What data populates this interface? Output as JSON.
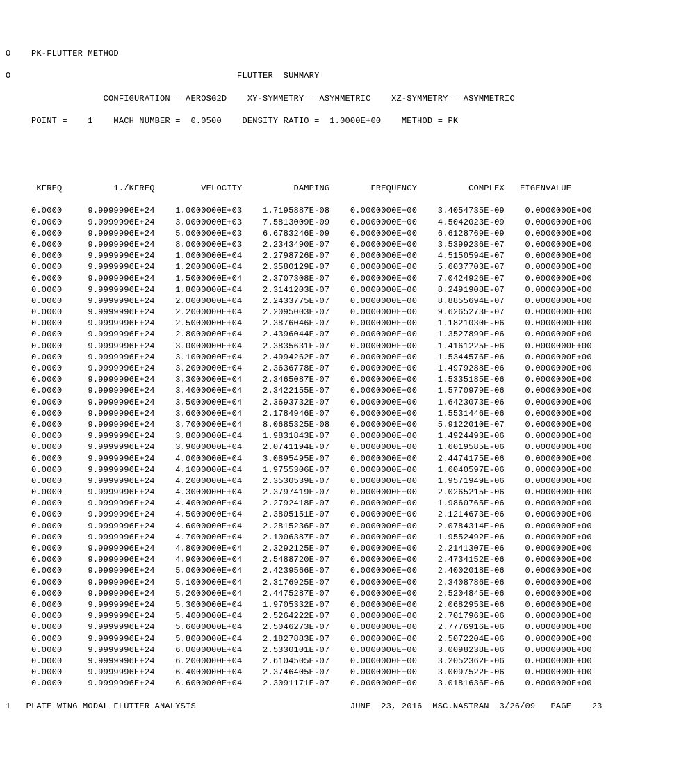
{
  "header": {
    "line0": "O    PK-FLUTTER METHOD",
    "line1": "O                                            FLUTTER  SUMMARY",
    "config_label": "CONFIGURATION =",
    "config_value": "AEROSG2D",
    "xy_label": "XY-SYMMETRY =",
    "xy_value": "ASYMMETRIC",
    "xz_label": "XZ-SYMMETRY =",
    "xz_value": "ASYMMETRIC",
    "point_label": "POINT =",
    "point_value": "1",
    "mach_label": "MACH NUMBER =",
    "mach_value": "0.0500",
    "density_label": "DENSITY RATIO =",
    "density_value": "1.0000E+00",
    "method_label": "METHOD =",
    "method_value": "PK"
  },
  "columns": [
    "KFREQ",
    "1./KFREQ",
    "VELOCITY",
    "DAMPING",
    "FREQUENCY",
    "COMPLEX",
    "EIGENVALUE"
  ],
  "rows": [
    [
      "0.0000",
      "9.9999996E+24",
      "1.0000000E+03",
      "1.7195887E-08",
      "0.0000000E+00",
      "3.4054735E-09",
      "0.0000000E+00"
    ],
    [
      "0.0000",
      "9.9999996E+24",
      "3.0000000E+03",
      "7.5813009E-09",
      "0.0000000E+00",
      "4.5042023E-09",
      "0.0000000E+00"
    ],
    [
      "0.0000",
      "9.9999996E+24",
      "5.0000000E+03",
      "6.6783246E-09",
      "0.0000000E+00",
      "6.6128769E-09",
      "0.0000000E+00"
    ],
    [
      "0.0000",
      "9.9999996E+24",
      "8.0000000E+03",
      "2.2343490E-07",
      "0.0000000E+00",
      "3.5399236E-07",
      "0.0000000E+00"
    ],
    [
      "0.0000",
      "9.9999996E+24",
      "1.0000000E+04",
      "2.2798726E-07",
      "0.0000000E+00",
      "4.5150594E-07",
      "0.0000000E+00"
    ],
    [
      "0.0000",
      "9.9999996E+24",
      "1.2000000E+04",
      "2.3580129E-07",
      "0.0000000E+00",
      "5.6037703E-07",
      "0.0000000E+00"
    ],
    [
      "0.0000",
      "9.9999996E+24",
      "1.5000000E+04",
      "2.3707308E-07",
      "0.0000000E+00",
      "7.0424926E-07",
      "0.0000000E+00"
    ],
    [
      "0.0000",
      "9.9999996E+24",
      "1.8000000E+04",
      "2.3141203E-07",
      "0.0000000E+00",
      "8.2491908E-07",
      "0.0000000E+00"
    ],
    [
      "0.0000",
      "9.9999996E+24",
      "2.0000000E+04",
      "2.2433775E-07",
      "0.0000000E+00",
      "8.8855694E-07",
      "0.0000000E+00"
    ],
    [
      "0.0000",
      "9.9999996E+24",
      "2.2000000E+04",
      "2.2095003E-07",
      "0.0000000E+00",
      "9.6265273E-07",
      "0.0000000E+00"
    ],
    [
      "0.0000",
      "9.9999996E+24",
      "2.5000000E+04",
      "2.3876046E-07",
      "0.0000000E+00",
      "1.1821030E-06",
      "0.0000000E+00"
    ],
    [
      "0.0000",
      "9.9999996E+24",
      "2.8000000E+04",
      "2.4396044E-07",
      "0.0000000E+00",
      "1.3527899E-06",
      "0.0000000E+00"
    ],
    [
      "0.0000",
      "9.9999996E+24",
      "3.0000000E+04",
      "2.3835631E-07",
      "0.0000000E+00",
      "1.4161225E-06",
      "0.0000000E+00"
    ],
    [
      "0.0000",
      "9.9999996E+24",
      "3.1000000E+04",
      "2.4994262E-07",
      "0.0000000E+00",
      "1.5344576E-06",
      "0.0000000E+00"
    ],
    [
      "0.0000",
      "9.9999996E+24",
      "3.2000000E+04",
      "2.3636778E-07",
      "0.0000000E+00",
      "1.4979288E-06",
      "0.0000000E+00"
    ],
    [
      "0.0000",
      "9.9999996E+24",
      "3.3000000E+04",
      "2.3465087E-07",
      "0.0000000E+00",
      "1.5335185E-06",
      "0.0000000E+00"
    ],
    [
      "0.0000",
      "9.9999996E+24",
      "3.4000000E+04",
      "2.3422155E-07",
      "0.0000000E+00",
      "1.5770979E-06",
      "0.0000000E+00"
    ],
    [
      "0.0000",
      "9.9999996E+24",
      "3.5000000E+04",
      "2.3693732E-07",
      "0.0000000E+00",
      "1.6423073E-06",
      "0.0000000E+00"
    ],
    [
      "0.0000",
      "9.9999996E+24",
      "3.6000000E+04",
      "2.1784946E-07",
      "0.0000000E+00",
      "1.5531446E-06",
      "0.0000000E+00"
    ],
    [
      "0.0000",
      "9.9999996E+24",
      "3.7000000E+04",
      "8.0685325E-08",
      "0.0000000E+00",
      "5.9122010E-07",
      "0.0000000E+00"
    ],
    [
      "0.0000",
      "9.9999996E+24",
      "3.8000000E+04",
      "1.9831843E-07",
      "0.0000000E+00",
      "1.4924493E-06",
      "0.0000000E+00"
    ],
    [
      "0.0000",
      "9.9999996E+24",
      "3.9000000E+04",
      "2.0741194E-07",
      "0.0000000E+00",
      "1.6019585E-06",
      "0.0000000E+00"
    ],
    [
      "0.0000",
      "9.9999996E+24",
      "4.0000000E+04",
      "3.0895495E-07",
      "0.0000000E+00",
      "2.4474175E-06",
      "0.0000000E+00"
    ],
    [
      "0.0000",
      "9.9999996E+24",
      "4.1000000E+04",
      "1.9755306E-07",
      "0.0000000E+00",
      "1.6040597E-06",
      "0.0000000E+00"
    ],
    [
      "0.0000",
      "9.9999996E+24",
      "4.2000000E+04",
      "2.3530539E-07",
      "0.0000000E+00",
      "1.9571949E-06",
      "0.0000000E+00"
    ],
    [
      "0.0000",
      "9.9999996E+24",
      "4.3000000E+04",
      "2.3797419E-07",
      "0.0000000E+00",
      "2.0265215E-06",
      "0.0000000E+00"
    ],
    [
      "0.0000",
      "9.9999996E+24",
      "4.4000000E+04",
      "2.2792418E-07",
      "0.0000000E+00",
      "1.9860765E-06",
      "0.0000000E+00"
    ],
    [
      "0.0000",
      "9.9999996E+24",
      "4.5000000E+04",
      "2.3805151E-07",
      "0.0000000E+00",
      "2.1214673E-06",
      "0.0000000E+00"
    ],
    [
      "0.0000",
      "9.9999996E+24",
      "4.6000000E+04",
      "2.2815236E-07",
      "0.0000000E+00",
      "2.0784314E-06",
      "0.0000000E+00"
    ],
    [
      "0.0000",
      "9.9999996E+24",
      "4.7000000E+04",
      "2.1006387E-07",
      "0.0000000E+00",
      "1.9552492E-06",
      "0.0000000E+00"
    ],
    [
      "0.0000",
      "9.9999996E+24",
      "4.8000000E+04",
      "2.3292125E-07",
      "0.0000000E+00",
      "2.2141307E-06",
      "0.0000000E+00"
    ],
    [
      "0.0000",
      "9.9999996E+24",
      "4.9000000E+04",
      "2.5488720E-07",
      "0.0000000E+00",
      "2.4734152E-06",
      "0.0000000E+00"
    ],
    [
      "0.0000",
      "9.9999996E+24",
      "5.0000000E+04",
      "2.4239566E-07",
      "0.0000000E+00",
      "2.4002018E-06",
      "0.0000000E+00"
    ],
    [
      "0.0000",
      "9.9999996E+24",
      "5.1000000E+04",
      "2.3176925E-07",
      "0.0000000E+00",
      "2.3408786E-06",
      "0.0000000E+00"
    ],
    [
      "0.0000",
      "9.9999996E+24",
      "5.2000000E+04",
      "2.4475287E-07",
      "0.0000000E+00",
      "2.5204845E-06",
      "0.0000000E+00"
    ],
    [
      "0.0000",
      "9.9999996E+24",
      "5.3000000E+04",
      "1.9705332E-07",
      "0.0000000E+00",
      "2.0682953E-06",
      "0.0000000E+00"
    ],
    [
      "0.0000",
      "9.9999996E+24",
      "5.4000000E+04",
      "2.5264222E-07",
      "0.0000000E+00",
      "2.7017963E-06",
      "0.0000000E+00"
    ],
    [
      "0.0000",
      "9.9999996E+24",
      "5.6000000E+04",
      "2.5046273E-07",
      "0.0000000E+00",
      "2.7776916E-06",
      "0.0000000E+00"
    ],
    [
      "0.0000",
      "9.9999996E+24",
      "5.8000000E+04",
      "2.1827883E-07",
      "0.0000000E+00",
      "2.5072204E-06",
      "0.0000000E+00"
    ],
    [
      "0.0000",
      "9.9999996E+24",
      "6.0000000E+04",
      "2.5330101E-07",
      "0.0000000E+00",
      "3.0098238E-06",
      "0.0000000E+00"
    ],
    [
      "0.0000",
      "9.9999996E+24",
      "6.2000000E+04",
      "2.6104505E-07",
      "0.0000000E+00",
      "3.2052362E-06",
      "0.0000000E+00"
    ],
    [
      "0.0000",
      "9.9999996E+24",
      "6.4000000E+04",
      "2.3746405E-07",
      "0.0000000E+00",
      "3.0097522E-06",
      "0.0000000E+00"
    ],
    [
      "0.0000",
      "9.9999996E+24",
      "6.6000000E+04",
      "2.3091171E-07",
      "0.0000000E+00",
      "3.0181636E-06",
      "0.0000000E+00"
    ]
  ],
  "footer": {
    "left": "1   PLATE WING MODAL FLUTTER ANALYSIS",
    "date": "JUNE  23, 2016",
    "version": "MSC.NASTRAN  3/26/09",
    "page_label": "PAGE",
    "page_num": "23"
  }
}
